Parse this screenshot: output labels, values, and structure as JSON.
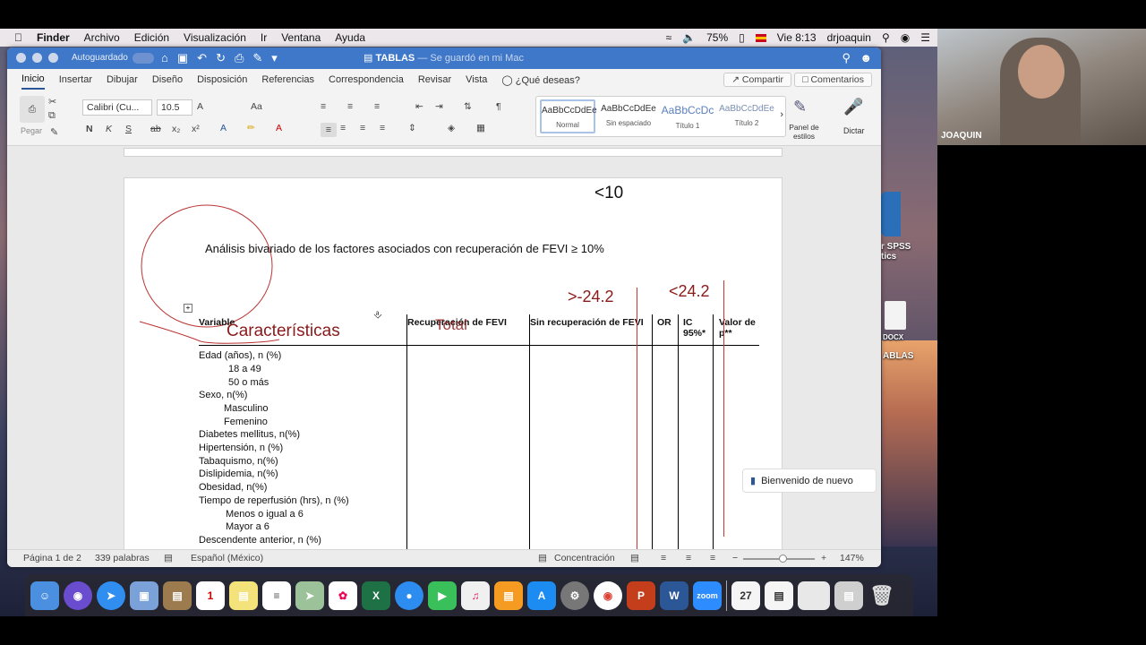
{
  "menubar": {
    "app": "Finder",
    "items": [
      "Archivo",
      "Edición",
      "Visualización",
      "Ir",
      "Ventana",
      "Ayuda"
    ],
    "battery": "75%",
    "clock": "Vie 8:13",
    "user": "drjoaquin"
  },
  "window": {
    "autosave_label": "Autoguardado",
    "doc_name": "TABLAS",
    "doc_status": "— Se guardó en mi Mac",
    "tabs": [
      "Inicio",
      "Insertar",
      "Dibujar",
      "Diseño",
      "Disposición",
      "Referencias",
      "Correspondencia",
      "Revisar",
      "Vista"
    ],
    "tell_me": "¿Qué deseas?",
    "share": "Compartir",
    "comments": "Comentarios"
  },
  "ribbon": {
    "paste": "Pegar",
    "font_name": "Calibri (Cu...",
    "font_size": "10.5",
    "styles": [
      {
        "preview": "AaBbCcDdEe",
        "name": "Normal"
      },
      {
        "preview": "AaBbCcDdEe",
        "name": "Sin espaciado"
      },
      {
        "preview": "AaBbCcDc",
        "name": "Título 1"
      },
      {
        "preview": "AaBbCcDdEe",
        "name": "Título 2"
      }
    ],
    "styles_pane": "Panel de estilos",
    "dictate": "Dictar"
  },
  "document": {
    "title": "Análisis bivariado de los factores asociados con recuperación de FEVI ≥ 10%",
    "headers": {
      "variable": "Variable",
      "recovered": "Recuperación de FEVI",
      "not_recovered": "Sin recuperación de FEVI",
      "or": "OR",
      "ic": "IC 95%*",
      "p": "Valor de p**"
    },
    "rows": [
      "Edad (años), n (%)",
      "18 a 49",
      "50  o más",
      "Sexo, n(%)",
      "Masculino",
      "Femenino",
      "Diabetes mellitus, n(%)",
      "Hipertensión, n (%)",
      "Tabaquismo, n(%)",
      "Dislipidemia, n(%)",
      "Obesidad, n(%)",
      "Tiempo de reperfusión (hrs), n (%)",
      "Menos o igual  a 6",
      "Mayor a 6",
      "Descendente anterior, n (%)"
    ],
    "annotations": {
      "lt10": "<10",
      "gt242": ">-24.2",
      "lt242": "<24.2",
      "caracteristicas": "Características",
      "total": "Total"
    }
  },
  "status": {
    "page": "Página 1 de 2",
    "words": "339 palabras",
    "language": "Español (México)",
    "focus": "Concentración",
    "zoom": "147%"
  },
  "toast": "Bienvenido de nuevo",
  "video": {
    "name": "JOAQUIN"
  },
  "desktop": {
    "spss": "r SPSS",
    "spss2": "tics",
    "docx": "DOCX",
    "tablas": "ABLAS"
  }
}
